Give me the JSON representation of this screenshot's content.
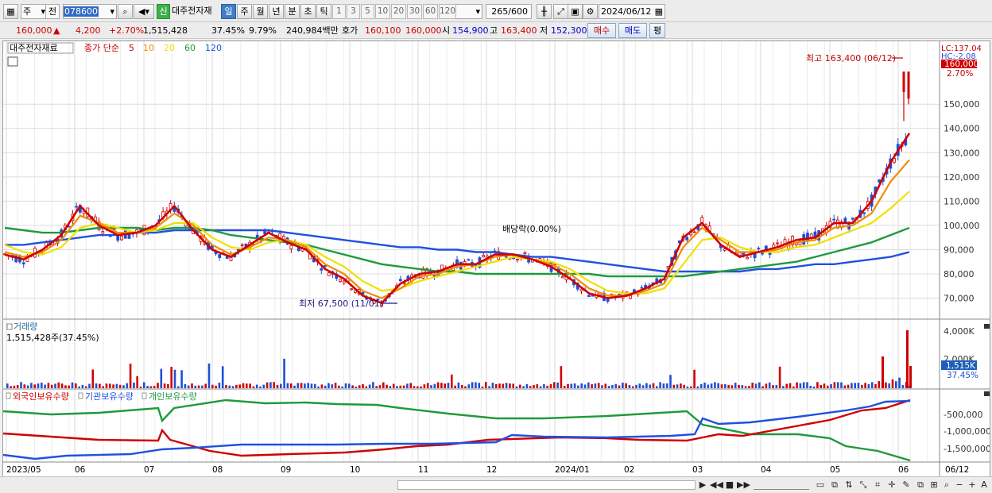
{
  "toolbar": {
    "code": "078600",
    "type_label": "주",
    "prev_label": "전",
    "new_label": "신",
    "stock_name": "대주전자재",
    "periods": [
      {
        "label": "일",
        "active": true
      },
      {
        "label": "주",
        "active": false
      },
      {
        "label": "월",
        "active": false
      },
      {
        "label": "년",
        "active": false
      },
      {
        "label": "분",
        "active": false
      },
      {
        "label": "초",
        "active": false
      },
      {
        "label": "틱",
        "active": false
      }
    ],
    "intervals": [
      "1",
      "3",
      "5",
      "10",
      "20",
      "30",
      "60",
      "120"
    ],
    "count": "265",
    "count_max": "/600",
    "date": "2024/06/12"
  },
  "quote": {
    "price": "160,000",
    "change": "4,200",
    "change_pct": "+2.70%",
    "volume": "1,515,428",
    "vol_ratio": "37.45%",
    "turnover": "9.79%",
    "amount": "240,984백만",
    "bid_label": "호가",
    "bid": "160,100",
    "ask": "160,000",
    "open_label": "시",
    "open": "154,900",
    "high_label": "고",
    "high": "163,400",
    "low_label": "저",
    "low": "152,300",
    "buy_label": "매수",
    "sell_label": "매도",
    "avg_label": "평"
  },
  "price_panel": {
    "name_tag": "대주전자재료",
    "legend_label": "종가 단순",
    "ma_periods": [
      "5",
      "10",
      "20",
      "60",
      "120"
    ],
    "ma_colors": [
      "#d00000",
      "#f08c00",
      "#f0e000",
      "#1e9a3c",
      "#2050e0"
    ],
    "high_annot": "최고 163,400 (06/12)",
    "low_annot": "최저 67,500 (11/01)",
    "dividend_annot": "배당락(0.00%)",
    "lc_label": "LC:137.04",
    "hc_label": "HC:-2.08",
    "current_price_tag": "160,000",
    "current_pct_tag": "2.70%",
    "y_ticks": [
      "150,000",
      "140,000",
      "130,000",
      "120,000",
      "110,000",
      "100,000",
      "90,000",
      "80,000",
      "70,000"
    ]
  },
  "volume_panel": {
    "title": "거래량",
    "value": "1,515,428주(37.45%)",
    "y_ticks": [
      "4,000K",
      "2,000K"
    ],
    "current_tag": "1,515K",
    "pct_tag": "37.45%"
  },
  "holding_panel": {
    "legend": [
      "외국인보유수량",
      "기관보유수량",
      "개인보유수량"
    ],
    "legend_colors": [
      "#d00000",
      "#2050e0",
      "#1e9a3c"
    ],
    "y_ticks": [
      "-500,000",
      "-1,000,000",
      "-1,500,000"
    ]
  },
  "x_axis": [
    "2023/05",
    "06",
    "07",
    "08",
    "09",
    "10",
    "11",
    "12",
    "2024/01",
    "02",
    "03",
    "04",
    "05",
    "06"
  ],
  "x_axis_right": "06/12",
  "chart_data": {
    "type": "line",
    "title": "",
    "ylim": [
      62000,
      172000
    ],
    "x_months": [
      "2023/05",
      "06",
      "07",
      "08",
      "09",
      "10",
      "11",
      "12",
      "2024/01",
      "02",
      "03",
      "04",
      "05",
      "06"
    ],
    "series": [
      {
        "name": "5",
        "values": [
          88000,
          86000,
          90000,
          96000,
          108000,
          100000,
          96000,
          97000,
          100000,
          108000,
          98000,
          90000,
          87000,
          92000,
          97000,
          93000,
          90000,
          82000,
          78000,
          71000,
          68000,
          76000,
          80000,
          81000,
          84000,
          84000,
          88000,
          88000,
          86000,
          83000,
          78000,
          72000,
          70000,
          71000,
          74000,
          78000,
          95000,
          101000,
          92000,
          87000,
          89000,
          91000,
          94000,
          95000,
          101000,
          101000,
          110000,
          126000,
          138000
        ]
      },
      {
        "name": "10",
        "values": [
          89000,
          87000,
          89000,
          94000,
          104000,
          101000,
          97000,
          97000,
          99000,
          105000,
          100000,
          92000,
          88000,
          91000,
          95000,
          94000,
          91000,
          84000,
          80000,
          73000,
          70000,
          74000,
          79000,
          80000,
          83000,
          84000,
          87000,
          88000,
          86000,
          84000,
          80000,
          74000,
          71000,
          71000,
          73000,
          76000,
          91000,
          99000,
          94000,
          89000,
          89000,
          90000,
          93000,
          94000,
          99000,
          100000,
          105000,
          118000,
          127000
        ]
      },
      {
        "name": "20",
        "values": [
          92000,
          89000,
          88000,
          91000,
          99000,
          101000,
          99000,
          97000,
          98000,
          101000,
          101000,
          95000,
          91000,
          90000,
          93000,
          94000,
          92000,
          87000,
          83000,
          77000,
          73000,
          74000,
          77000,
          79000,
          81000,
          83000,
          85000,
          87000,
          86000,
          85000,
          82000,
          77000,
          73000,
          72000,
          72000,
          74000,
          84000,
          94000,
          95000,
          91000,
          89000,
          89000,
          91000,
          92000,
          95000,
          98000,
          101000,
          107000,
          114000
        ]
      },
      {
        "name": "60",
        "values": [
          99000,
          98000,
          97000,
          97000,
          98000,
          99000,
          99000,
          99000,
          98000,
          99000,
          99000,
          98000,
          96000,
          95000,
          94000,
          93000,
          92000,
          90000,
          88000,
          86000,
          84000,
          83000,
          82000,
          81000,
          81000,
          80000,
          80000,
          80000,
          80000,
          80000,
          80000,
          80000,
          79000,
          79000,
          79000,
          79000,
          79000,
          80000,
          81000,
          82000,
          83000,
          84000,
          85000,
          87000,
          89000,
          91000,
          93000,
          96000,
          99000
        ]
      },
      {
        "name": "120",
        "values": [
          92000,
          92000,
          93000,
          94000,
          95000,
          96000,
          96000,
          97000,
          97000,
          98000,
          98000,
          98000,
          98000,
          98000,
          98000,
          97000,
          96000,
          95000,
          94000,
          93000,
          92000,
          91000,
          91000,
          90000,
          90000,
          89000,
          89000,
          88000,
          87000,
          87000,
          86000,
          85000,
          84000,
          83000,
          82000,
          81000,
          81000,
          81000,
          81000,
          81000,
          82000,
          82000,
          83000,
          84000,
          84000,
          85000,
          86000,
          87000,
          89000
        ]
      }
    ]
  }
}
